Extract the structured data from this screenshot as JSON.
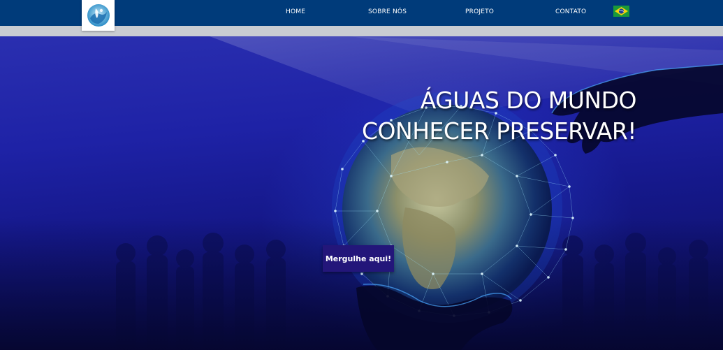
{
  "header": {
    "logo_icon": "water-drop-wave-logo",
    "nav": [
      {
        "label": "HOME"
      },
      {
        "label": "SOBRE NÓS"
      },
      {
        "label": "PROJETO"
      },
      {
        "label": "CONTATO"
      }
    ],
    "language_icon": "brazil-flag-icon"
  },
  "hero": {
    "headline_line1": "ÁGUAS DO MUNDO",
    "headline_line2": "CONHECER PRESERVAR!",
    "cta_label": "Mergulhe aqui!"
  },
  "colors": {
    "topbar": "#003b7a",
    "greybar": "#c9ccd2",
    "hero_blue": "#1e22a6",
    "cta": "#23167a"
  }
}
